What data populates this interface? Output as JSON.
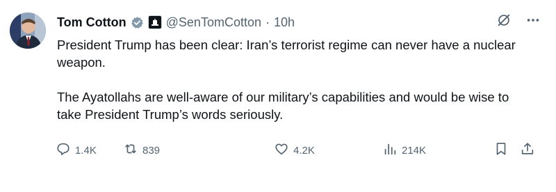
{
  "author": {
    "name": "Tom Cotton",
    "handle": "@SenTomCotton",
    "separator": "·",
    "time": "10h",
    "verified_badge_icon": "verified-badge-icon",
    "affiliation_badge_icon": "government-affiliation-badge-icon"
  },
  "tweet": {
    "paragraphs": [
      "President Trump has been clear: Iran’s terrorist regime can never have a nuclear weapon.",
      "The Ayatollahs are well-aware of our military’s capabilities and would be wise to take President Trump’s words seriously."
    ]
  },
  "metrics": {
    "replies": "1.4K",
    "reposts": "839",
    "likes": "4.2K",
    "views": "214K"
  },
  "icons": {
    "top_right": [
      "grok-icon",
      "more-icon"
    ],
    "actions": [
      "reply-icon",
      "repost-icon",
      "like-icon",
      "views-icon",
      "bookmark-icon",
      "share-icon"
    ]
  },
  "colors": {
    "text": "#0f1419",
    "secondary": "#536471",
    "verified": "#829aab",
    "background": "#ffffff"
  }
}
